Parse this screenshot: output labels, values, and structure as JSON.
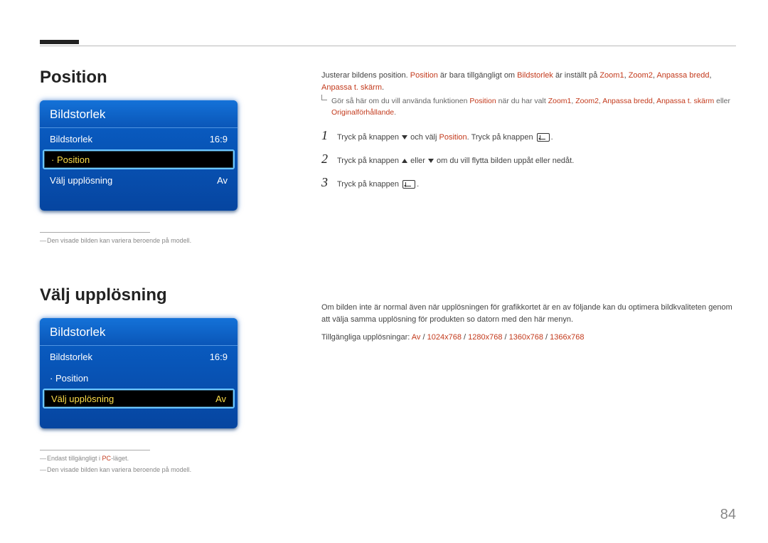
{
  "pageNumber": "84",
  "section1": {
    "title": "Position",
    "menu": {
      "title": "Bildstorlek",
      "rows": [
        {
          "label": "Bildstorlek",
          "value": "16:9",
          "selected": false,
          "indent": false
        },
        {
          "label": "Position",
          "value": "",
          "selected": true,
          "indent": true
        },
        {
          "label": "Välj upplösning",
          "value": "Av",
          "selected": false,
          "indent": false
        }
      ]
    },
    "notes": [
      {
        "text": "Den visade bilden kan variera beroende på modell."
      }
    ],
    "right": {
      "intro_a": "Justerar bildens position. ",
      "intro_hl1": "Position",
      "intro_b": " är bara tillgängligt om ",
      "intro_hl2": "Bildstorlek",
      "intro_c": " är inställt på ",
      "intro_hl3": "Zoom1",
      "intro_hl4": "Zoom2",
      "intro_hl5": "Anpassa bredd",
      "intro_hl6": "Anpassa t. skärm",
      "sub_a": "Gör så här om du vill använda funktionen ",
      "sub_hl1": "Position",
      "sub_b": " när du har valt ",
      "sub_hl2": "Zoom1",
      "sub_hl3": "Zoom2",
      "sub_hl4": "Anpassa bredd",
      "sub_hl5": "Anpassa t. skärm",
      "sub_c": " eller ",
      "sub_hl6": "Originalförhållande",
      "step1_a": "Tryck på knappen ",
      "step1_b": " och välj ",
      "step1_hl": "Position",
      "step1_c": ". Tryck på knappen ",
      "step2_a": "Tryck på knappen ",
      "step2_b": " eller ",
      "step2_c": " om du vill flytta bilden uppåt eller nedåt.",
      "step3_a": "Tryck på knappen ",
      "numbers": {
        "s1": "1",
        "s2": "2",
        "s3": "3"
      }
    }
  },
  "section2": {
    "title": "Välj upplösning",
    "menu": {
      "title": "Bildstorlek",
      "rows": [
        {
          "label": "Bildstorlek",
          "value": "16:9",
          "selected": false,
          "indent": false
        },
        {
          "label": "Position",
          "value": "",
          "selected": false,
          "indent": true
        },
        {
          "label": "Välj upplösning",
          "value": "Av",
          "selected": true,
          "indent": false
        }
      ]
    },
    "notes": [
      {
        "pre": "Endast tillgängligt i ",
        "hl": "PC",
        "post": "-läget."
      },
      {
        "text": "Den visade bilden kan variera beroende på modell."
      }
    ],
    "right": {
      "para": "Om bilden inte är normal även när upplösningen för grafikkortet är en av följande kan du optimera bildkvaliteten genom att välja samma upplösning för produkten so datorn med den här menyn.",
      "avail_a": "Tillgängliga upplösningar: ",
      "avail_hl1": "Av",
      "avail_hl2": "1024x768",
      "avail_hl3": "1280x768",
      "avail_hl4": "1360x768",
      "avail_hl5": "1366x768"
    }
  }
}
